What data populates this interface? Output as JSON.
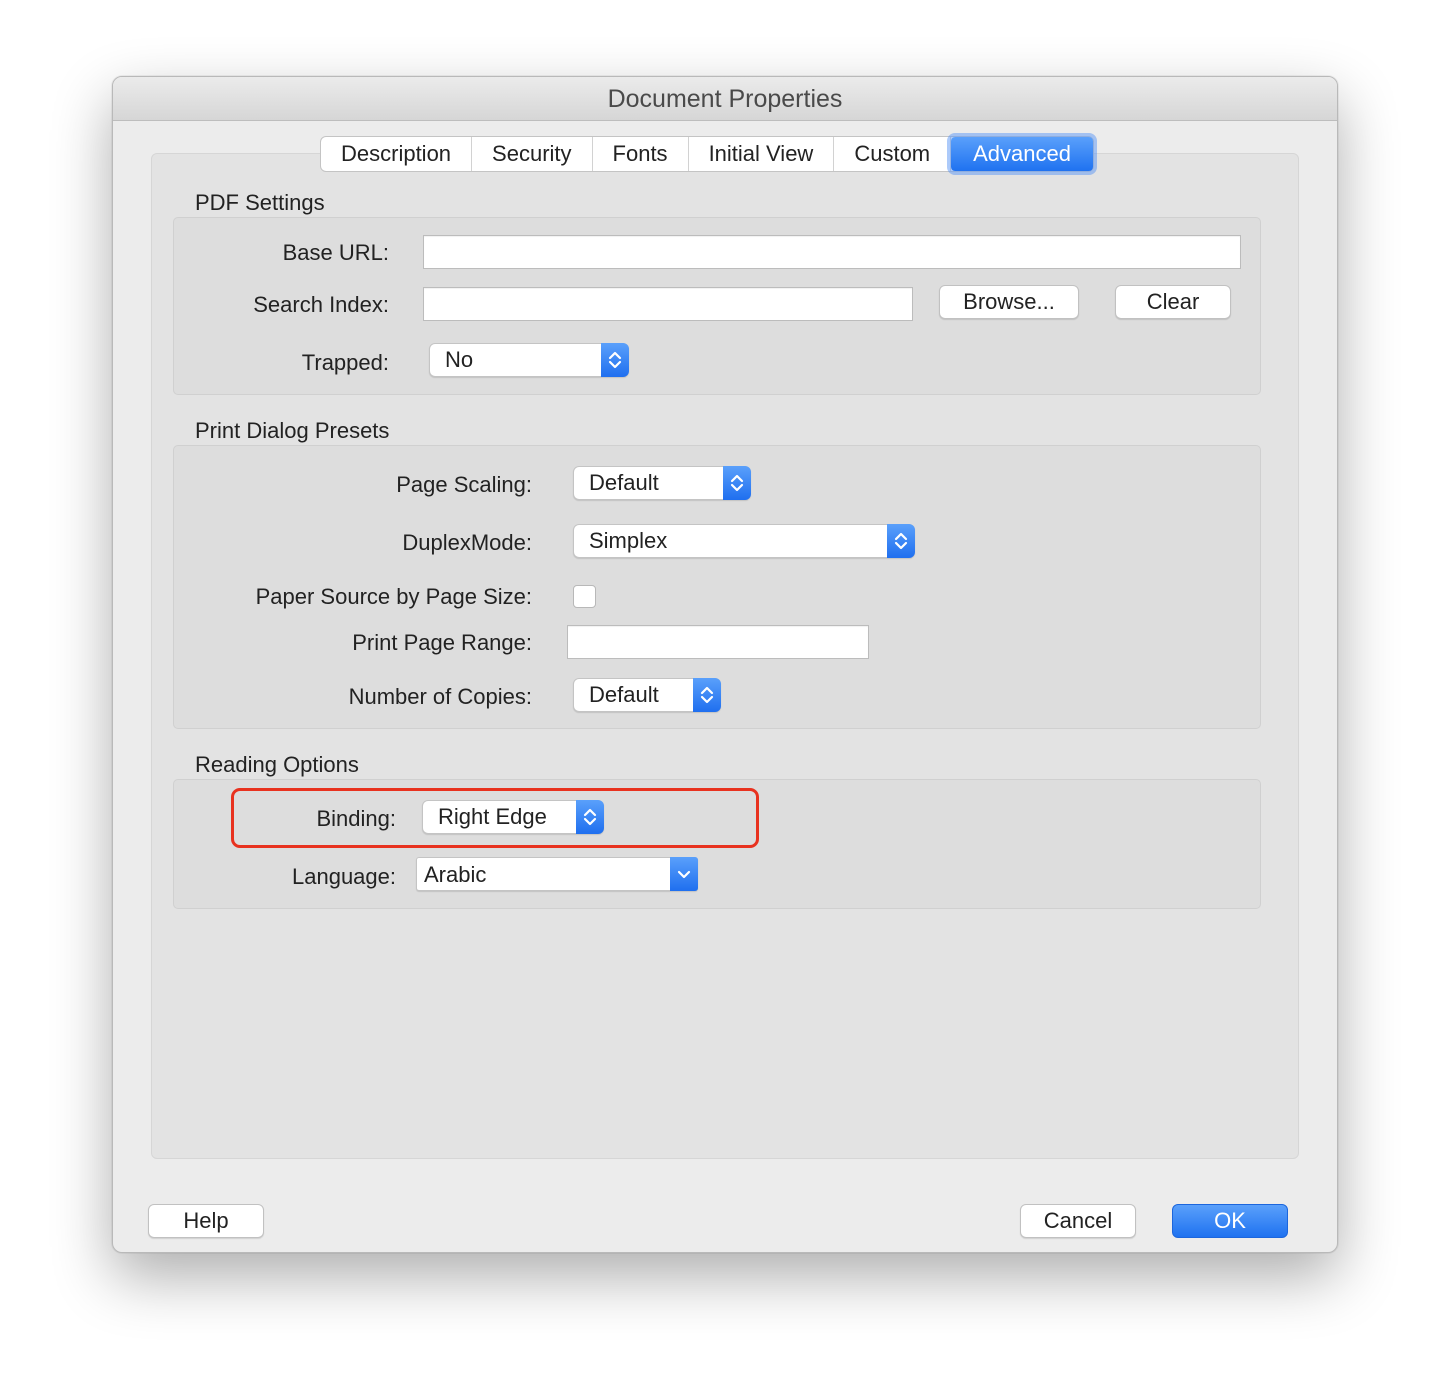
{
  "window": {
    "title": "Document Properties"
  },
  "tabs": [
    {
      "label": "Description"
    },
    {
      "label": "Security"
    },
    {
      "label": "Fonts"
    },
    {
      "label": "Initial View"
    },
    {
      "label": "Custom"
    },
    {
      "label": "Advanced",
      "active": true
    }
  ],
  "pdf_settings": {
    "title": "PDF Settings",
    "base_url_label": "Base URL:",
    "base_url_value": "",
    "search_index_label": "Search Index:",
    "search_index_value": "",
    "browse_label": "Browse...",
    "clear_label": "Clear",
    "trapped_label": "Trapped:",
    "trapped_value": "No"
  },
  "print_presets": {
    "title": "Print Dialog Presets",
    "page_scaling_label": "Page Scaling:",
    "page_scaling_value": "Default",
    "duplex_label": "DuplexMode:",
    "duplex_value": "Simplex",
    "paper_source_label": "Paper Source by Page Size:",
    "paper_source_checked": false,
    "page_range_label": "Print Page Range:",
    "page_range_value": "",
    "copies_label": "Number of Copies:",
    "copies_value": "Default"
  },
  "reading_options": {
    "title": "Reading Options",
    "binding_label": "Binding:",
    "binding_value": "Right Edge",
    "language_label": "Language:",
    "language_value": "Arabic"
  },
  "footer": {
    "help_label": "Help",
    "cancel_label": "Cancel",
    "ok_label": "OK"
  },
  "colors": {
    "accent": "#1f72f0",
    "highlight": "#e8321f"
  }
}
